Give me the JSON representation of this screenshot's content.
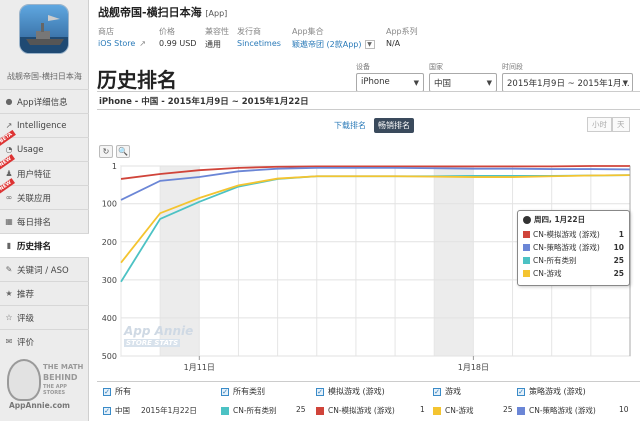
{
  "app": {
    "name": "战舰帝国-横扫日本海",
    "tag": "[App]",
    "caption": "战舰帝国-横扫日本海"
  },
  "meta": [
    {
      "key": "商店",
      "value": "iOS Store",
      "link": true,
      "icon": "external-link-icon"
    },
    {
      "key": "价格",
      "value": "0.99 USD",
      "link": false
    },
    {
      "key": "兼容性",
      "value": "通用",
      "link": false
    },
    {
      "key": "发行商",
      "value": "Sincetimes",
      "link": true
    },
    {
      "key": "App集合",
      "value": "颖遨帝团 (2款App)",
      "link": true,
      "dropdown": true
    },
    {
      "key": "App系列",
      "value": "N/A",
      "link": false
    }
  ],
  "sidebar": {
    "items": [
      {
        "label": "App详细信息",
        "icon": "info-icon",
        "badge": ""
      },
      {
        "label": "Intelligence",
        "icon": "trend-icon",
        "badge": ""
      },
      {
        "label": "Usage",
        "icon": "usage-icon",
        "badge": "BETA"
      },
      {
        "label": "用户特征",
        "icon": "users-icon",
        "badge": "NEW"
      },
      {
        "label": "关联应用",
        "icon": "link-icon",
        "badge": "NEW"
      },
      {
        "label": "每日排名",
        "icon": "calendar-icon",
        "badge": ""
      },
      {
        "label": "历史排名",
        "icon": "chart-icon",
        "badge": "",
        "active": true
      },
      {
        "label": "关键词 / ASO",
        "icon": "key-icon",
        "badge": ""
      },
      {
        "label": "推荐",
        "icon": "star-icon",
        "badge": ""
      },
      {
        "label": "评级",
        "icon": "rating-icon",
        "badge": ""
      },
      {
        "label": "评价",
        "icon": "comment-icon",
        "badge": ""
      }
    ],
    "promo": {
      "line1": "THE MATH",
      "line2": "BEHIND",
      "line3": "THE APP STORES",
      "url": "AppAnnie.com"
    }
  },
  "page_title": "历史排名",
  "filters": {
    "device": {
      "label": "设备",
      "value": "iPhone"
    },
    "country": {
      "label": "国家",
      "value": "中国"
    },
    "period": {
      "label": "时间段",
      "value": "2015年1月9日 ~ 2015年1月..."
    }
  },
  "subtitle": "iPhone - 中国 - 2015年1月9日 ~ 2015年1月22日",
  "tabs": [
    {
      "label": "下载排名",
      "active": false
    },
    {
      "label": "畅销排名",
      "active": true
    }
  ],
  "granularity": [
    "小时",
    "天"
  ],
  "tools": [
    "↻",
    "🔍"
  ],
  "tooltip": {
    "date": "周四, 1月22日",
    "rows": [
      {
        "name": "CN-模拟游戏 (游戏)",
        "value": "1",
        "color": "#d0443a"
      },
      {
        "name": "CN-策略游戏 (游戏)",
        "value": "10",
        "color": "#6b86d6"
      },
      {
        "name": "CN-所有类别",
        "value": "25",
        "color": "#4cc2c4"
      },
      {
        "name": "CN-游戏",
        "value": "25",
        "color": "#f4c430"
      }
    ]
  },
  "watermark": {
    "line1": "App Annie",
    "line2": "STORE STATS"
  },
  "legend": [
    {
      "label": "所有"
    },
    {
      "label": "所有类别"
    },
    {
      "label": "模拟游戏 (游戏)"
    },
    {
      "label": "游戏"
    },
    {
      "label": "策略游戏 (游戏)"
    }
  ],
  "data_row": {
    "country": "中国",
    "date": "2015年1月22日",
    "cells": [
      {
        "name": "CN-所有类别",
        "value": "25",
        "color": "#4cc2c4"
      },
      {
        "name": "CN-模拟游戏 (游戏)",
        "value": "1",
        "color": "#d0443a"
      },
      {
        "name": "CN-游戏",
        "value": "25",
        "color": "#f4c430"
      },
      {
        "name": "CN-策略游戏 (游戏)",
        "value": "10",
        "color": "#6b86d6"
      }
    ]
  },
  "chart_data": {
    "type": "line",
    "x": [
      "1月9日",
      "1月10日",
      "1月11日",
      "1月12日",
      "1月13日",
      "1月14日",
      "1月15日",
      "1月16日",
      "1月17日",
      "1月18日",
      "1月19日",
      "1月20日",
      "1月21日",
      "1月22日"
    ],
    "y_ticks": [
      1,
      100,
      200,
      300,
      400,
      500
    ],
    "x_tick_labels": [
      {
        "x": "1月11日",
        "label": "1月11日"
      },
      {
        "x": "1月18日",
        "label": "1月18日"
      }
    ],
    "ylim": [
      1,
      500
    ],
    "y_inverted": true,
    "shaded_weekends": [
      [
        "1月10日",
        "1月11日"
      ],
      [
        "1月17日",
        "1月18日"
      ]
    ],
    "series": [
      {
        "name": "CN-模拟游戏 (游戏)",
        "color": "#d0443a",
        "values": [
          35,
          22,
          12,
          6,
          3,
          2,
          2,
          2,
          2,
          2,
          2,
          2,
          1,
          1
        ]
      },
      {
        "name": "CN-策略游戏 (游戏)",
        "color": "#6b86d6",
        "values": [
          90,
          40,
          30,
          15,
          8,
          6,
          6,
          6,
          7,
          8,
          8,
          9,
          9,
          10
        ]
      },
      {
        "name": "CN-所有类别",
        "color": "#4cc2c4",
        "values": [
          305,
          140,
          95,
          55,
          35,
          28,
          28,
          28,
          28,
          27,
          27,
          27,
          26,
          25
        ]
      },
      {
        "name": "CN-游戏",
        "color": "#f4c430",
        "values": [
          255,
          125,
          85,
          52,
          34,
          28,
          28,
          28,
          29,
          30,
          30,
          28,
          26,
          25
        ]
      }
    ]
  }
}
